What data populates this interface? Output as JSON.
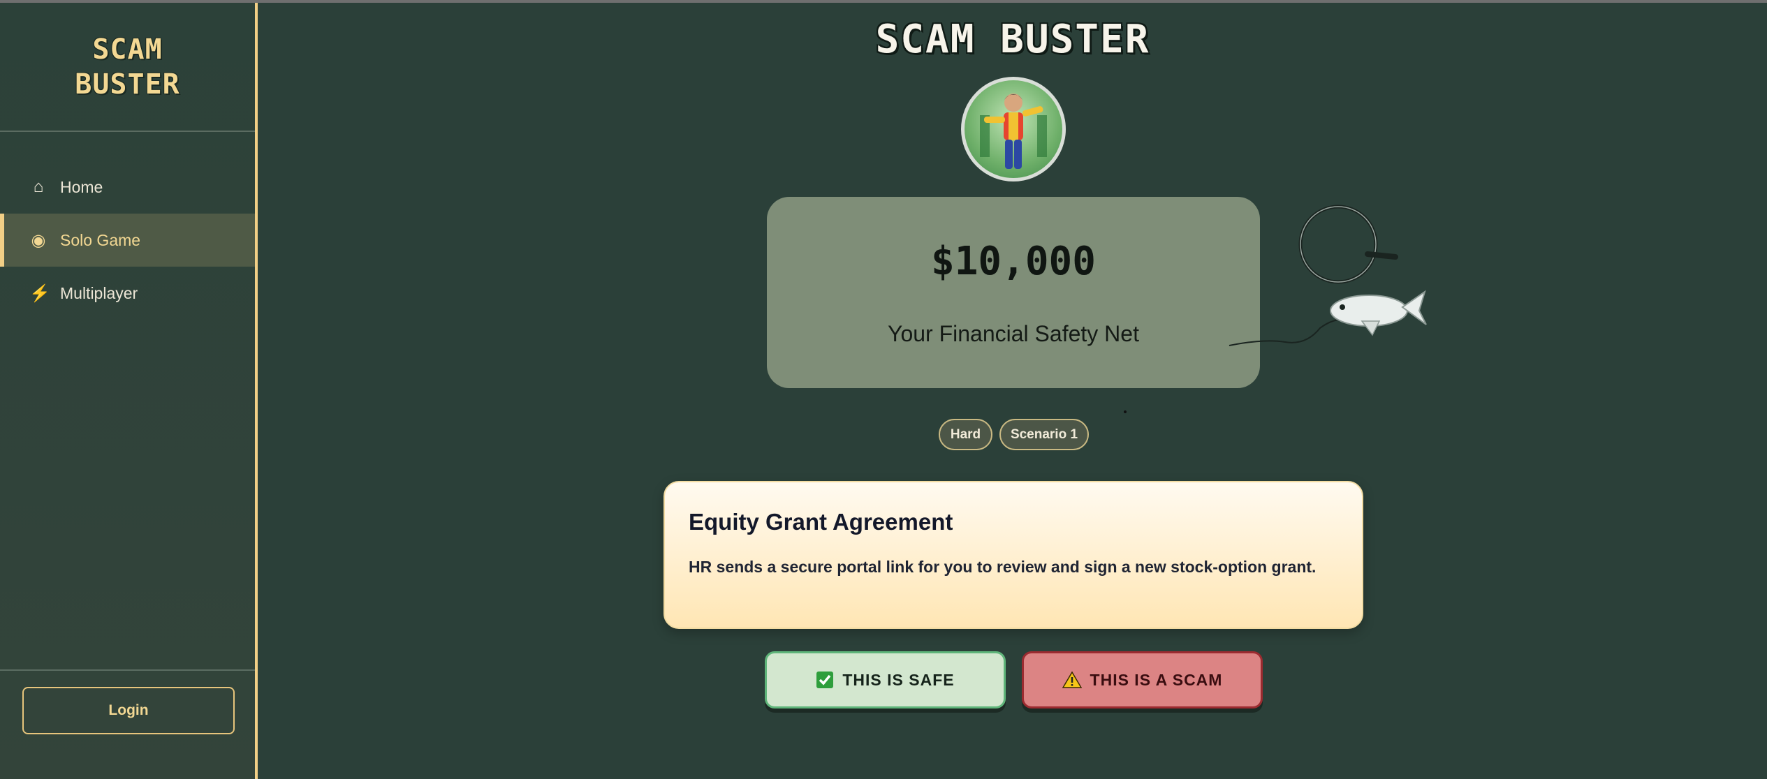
{
  "app": {
    "logo_line1": "SCAM",
    "logo_line2": "BUSTER",
    "title": "SCAM BUSTER"
  },
  "sidebar": {
    "items": [
      {
        "label": "Home",
        "icon": "home-icon",
        "active": false
      },
      {
        "label": "Solo Game",
        "icon": "target-icon",
        "active": true
      },
      {
        "label": "Multiplayer",
        "icon": "lightning-icon",
        "active": false
      }
    ],
    "login_label": "Login"
  },
  "wallet": {
    "amount": "$10,000",
    "label": "Your Financial Safety Net"
  },
  "tags": {
    "difficulty": "Hard",
    "scenario": "Scenario 1"
  },
  "scenario": {
    "title": "Equity Grant Agreement",
    "description": "HR sends a secure portal link for you to review and sign a new stock-option grant."
  },
  "actions": {
    "safe_label": "THIS IS SAFE",
    "scam_label": "THIS IS A SCAM"
  },
  "colors": {
    "background": "#2b4039",
    "accent": "#f2cf86",
    "safe": "#d3e7cf",
    "scam": "#dc8484"
  }
}
